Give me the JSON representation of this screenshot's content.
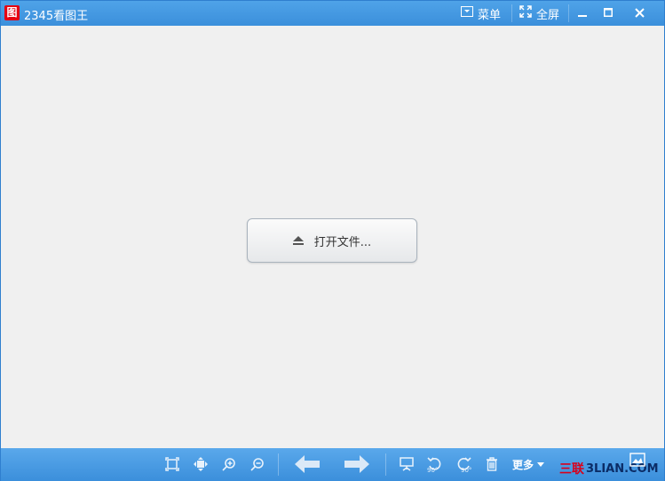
{
  "app": {
    "logo_glyph": "图",
    "title": "2345看图王"
  },
  "titlebar": {
    "menu_label": "菜单",
    "fullscreen_label": "全屏"
  },
  "content": {
    "open_file_label": "打开文件..."
  },
  "toolbar": {
    "more_label": "更多",
    "rotate_left_badge": "90°",
    "rotate_right_badge": "90°"
  },
  "watermark": {
    "part_a": "三联",
    "part_b": "3LIAN.COM"
  },
  "colors": {
    "titlebar": "#3b8fdb",
    "content_bg": "#f0f0f0",
    "logo_red": "#e60012"
  }
}
